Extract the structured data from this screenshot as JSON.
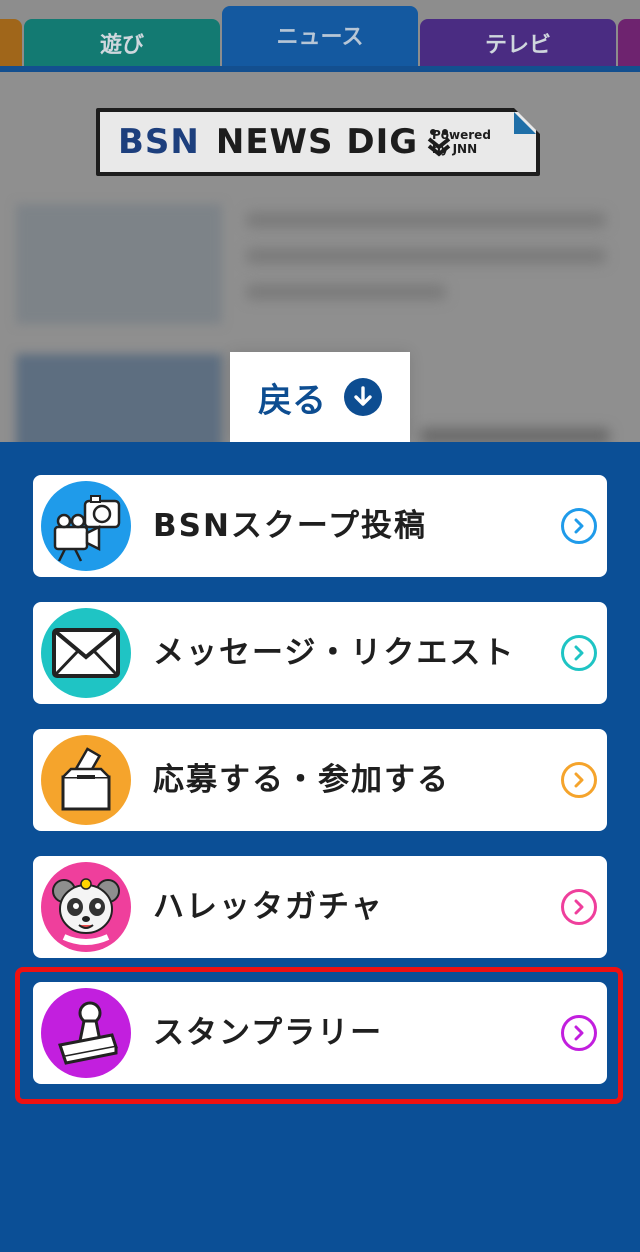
{
  "tabs": [
    {
      "label": "",
      "color": "#c87d1b"
    },
    {
      "label": "遊び",
      "color": "#15a296"
    },
    {
      "label": "ニュース",
      "color": "#1459a0",
      "active": true
    },
    {
      "label": "テレビ",
      "color": "#6a3aa7"
    },
    {
      "label": "",
      "color": "#8e2b8f"
    }
  ],
  "background_page": {
    "logo": {
      "brand": "BSN",
      "name": "NEWS DIG",
      "powered_by": "Powered by JNN"
    }
  },
  "back_button": {
    "label": "戻る",
    "icon": "arrow-down-circle-icon"
  },
  "menu": {
    "items": [
      {
        "label": "BSNスクープ投稿",
        "icon": "camera-icon",
        "color": "#1f9bea"
      },
      {
        "label": "メッセージ・リクエスト",
        "icon": "envelope-icon",
        "color": "#1fc4c4"
      },
      {
        "label": "応募する・参加する",
        "icon": "ballot-box-icon",
        "color": "#f5a42c"
      },
      {
        "label": "ハレッタガチャ",
        "icon": "mascot-icon",
        "color": "#ef3f9c"
      },
      {
        "label": "スタンプラリー",
        "icon": "stamp-icon",
        "color": "#c21fde"
      }
    ],
    "highlighted_index": 4,
    "highlight_color": "#ee1111"
  }
}
